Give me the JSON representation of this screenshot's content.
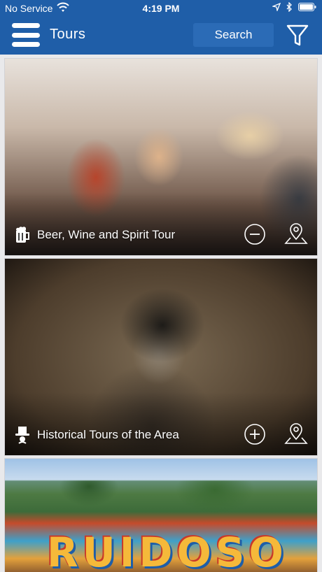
{
  "status_bar": {
    "carrier": "No Service",
    "time": "4:19 PM"
  },
  "header": {
    "title": "Tours",
    "search_label": "Search",
    "accent_color": "#1f5ea8"
  },
  "tours": [
    {
      "title": "Beer, Wine and Spirit Tour",
      "category_icon": "beer-mug-icon",
      "action_icon": "remove-circle-icon",
      "map_icon": "map-pin-icon"
    },
    {
      "title": "Historical Tours of the Area",
      "category_icon": "top-hat-icon",
      "action_icon": "add-circle-icon",
      "map_icon": "map-pin-icon"
    },
    {
      "title": "",
      "mural_text": "RUIDOSO",
      "category_icon": "",
      "action_icon": "",
      "map_icon": ""
    }
  ]
}
